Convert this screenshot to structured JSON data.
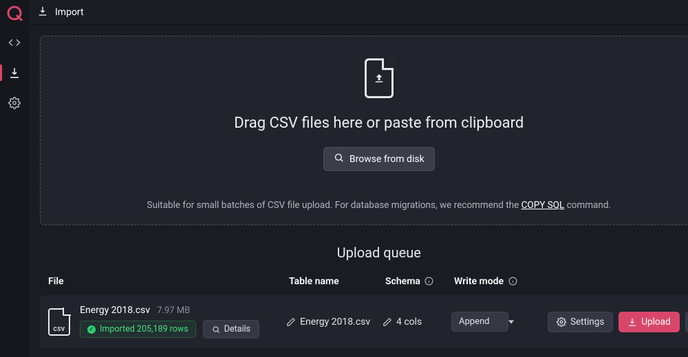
{
  "sidebar": {
    "items": [
      {
        "name": "code",
        "active": false
      },
      {
        "name": "import",
        "active": true
      },
      {
        "name": "settings",
        "active": false
      }
    ]
  },
  "topbar": {
    "title": "Import"
  },
  "dropzone": {
    "title": "Drag CSV files here or paste from clipboard",
    "browse_label": "Browse from disk",
    "hint_prefix": "Suitable for small batches of CSV file upload. For database migrations, we recommend the ",
    "hint_link": "COPY SQL",
    "hint_suffix": " command."
  },
  "queue": {
    "title": "Upload queue",
    "headers": {
      "file": "File",
      "table": "Table name",
      "schema": "Schema",
      "mode": "Write mode"
    },
    "rows": [
      {
        "file_icon_label": "CSV",
        "file_name": "Energy 2018.csv",
        "file_size": "7.97 MB",
        "status": "Imported 205,189 rows",
        "details_label": "Details",
        "table_name": "Energy 2018.csv",
        "schema": "4 cols",
        "write_mode": "Append",
        "settings_label": "Settings",
        "upload_label": "Upload"
      }
    ]
  }
}
